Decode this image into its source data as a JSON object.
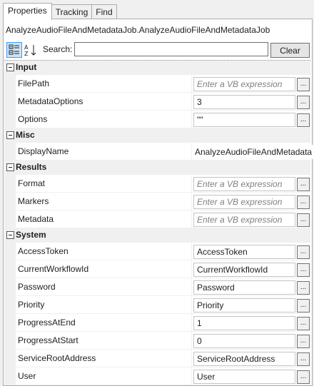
{
  "tabs": [
    "Properties",
    "Tracking",
    "Find"
  ],
  "type_name": "AnalyzeAudioFileAndMetadataJob.AnalyzeAudioFileAndMetadataJob",
  "toolbar": {
    "search_label": "Search:",
    "search_value": "",
    "clear_label": "Clear"
  },
  "ellipsis_label": "...",
  "categories": [
    {
      "name": "Input",
      "props": [
        {
          "name": "FilePath",
          "value": "Enter a VB expression",
          "placeholder": true
        },
        {
          "name": "MetadataOptions",
          "value": "3"
        },
        {
          "name": "Options",
          "value": "\"\""
        }
      ]
    },
    {
      "name": "Misc",
      "props": [
        {
          "name": "DisplayName",
          "value": "AnalyzeAudioFileAndMetadata",
          "plain": true
        }
      ]
    },
    {
      "name": "Results",
      "props": [
        {
          "name": "Format",
          "value": "Enter a VB expression",
          "placeholder": true
        },
        {
          "name": "Markers",
          "value": "Enter a VB expression",
          "placeholder": true
        },
        {
          "name": "Metadata",
          "value": "Enter a VB expression",
          "placeholder": true
        }
      ]
    },
    {
      "name": "System",
      "props": [
        {
          "name": "AccessToken",
          "value": "AccessToken"
        },
        {
          "name": "CurrentWorkflowId",
          "value": "CurrentWorkflowId"
        },
        {
          "name": "Password",
          "value": "Password"
        },
        {
          "name": "Priority",
          "value": "Priority"
        },
        {
          "name": "ProgressAtEnd",
          "value": "1"
        },
        {
          "name": "ProgressAtStart",
          "value": "0"
        },
        {
          "name": "ServiceRootAddress",
          "value": "ServiceRootAddress"
        },
        {
          "name": "User",
          "value": "User"
        }
      ]
    }
  ]
}
